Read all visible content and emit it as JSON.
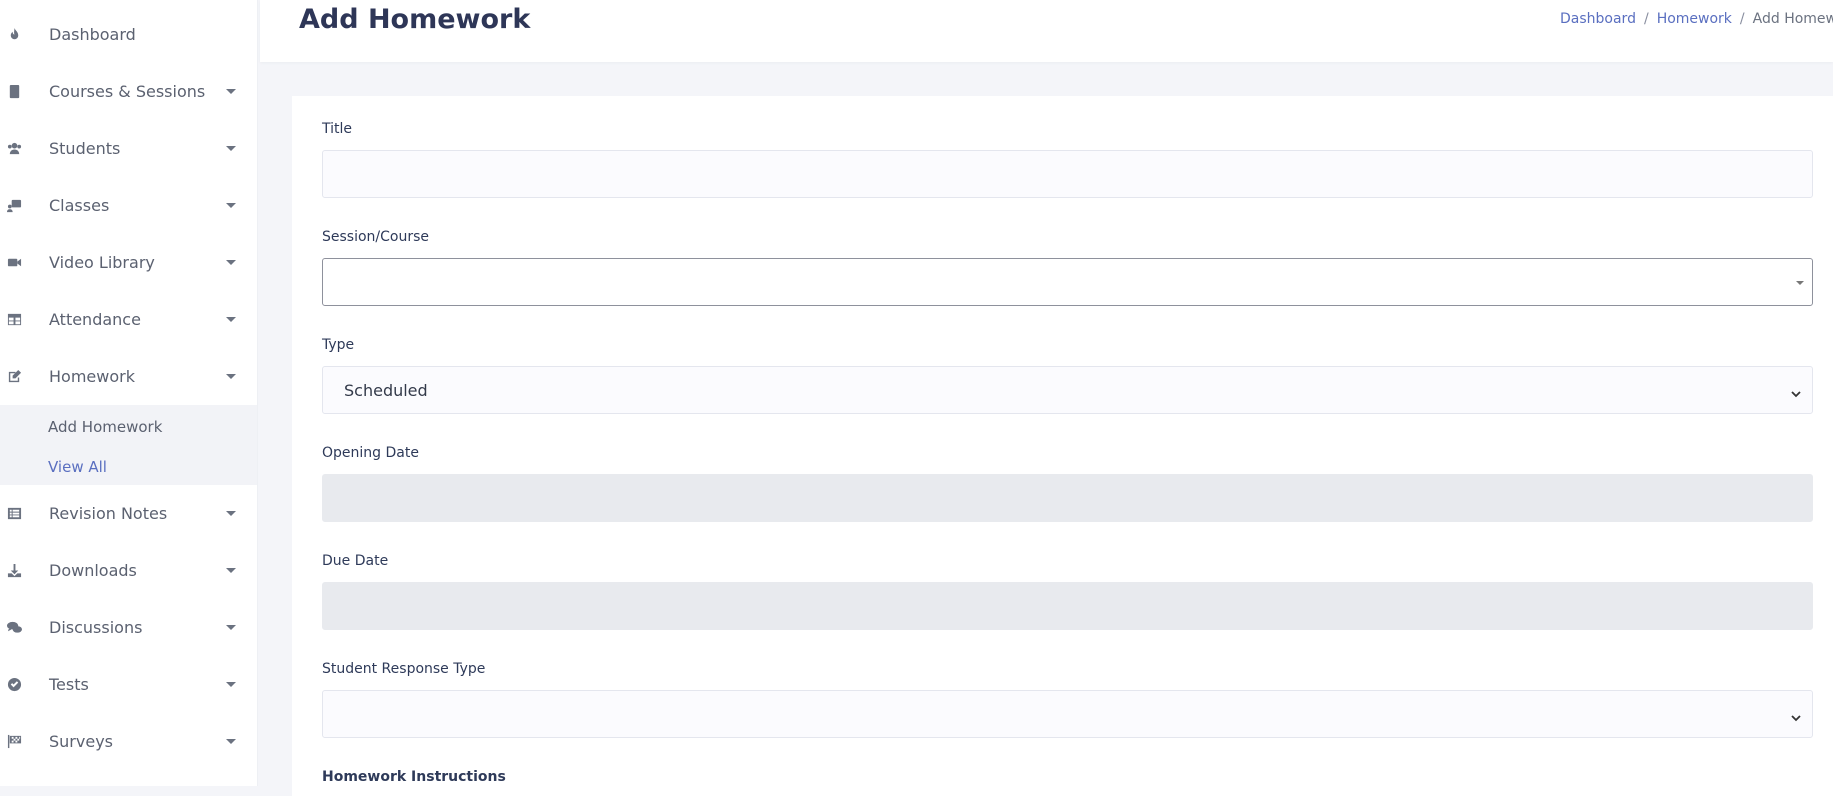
{
  "sidebar": {
    "items": [
      {
        "label": "Dashboard",
        "icon": "fire-icon",
        "has_caret": false
      },
      {
        "label": "Courses & Sessions",
        "icon": "book-icon",
        "has_caret": true
      },
      {
        "label": "Students",
        "icon": "users-icon",
        "has_caret": true
      },
      {
        "label": "Classes",
        "icon": "chalkboard-teacher-icon",
        "has_caret": true
      },
      {
        "label": "Video Library",
        "icon": "video-icon",
        "has_caret": true
      },
      {
        "label": "Attendance",
        "icon": "table-icon",
        "has_caret": true
      },
      {
        "label": "Homework",
        "icon": "edit-icon",
        "has_caret": true
      },
      {
        "label": "Revision Notes",
        "icon": "list-icon",
        "has_caret": true
      },
      {
        "label": "Downloads",
        "icon": "download-icon",
        "has_caret": true
      },
      {
        "label": "Discussions",
        "icon": "comments-icon",
        "has_caret": true
      },
      {
        "label": "Tests",
        "icon": "check-circle-icon",
        "has_caret": true
      },
      {
        "label": "Surveys",
        "icon": "flag-checkered-icon",
        "has_caret": true
      }
    ],
    "submenu": {
      "add_label": "Add Homework",
      "view_label": "View All"
    }
  },
  "header": {
    "title": "Add Homework",
    "breadcrumb": [
      "Dashboard",
      "Homework",
      "Add Homework"
    ]
  },
  "form": {
    "title_label": "Title",
    "title_value": "",
    "session_label": "Session/Course",
    "session_value": "",
    "type_label": "Type",
    "type_value": "Scheduled",
    "opening_label": "Opening Date",
    "opening_value": "",
    "due_label": "Due Date",
    "due_value": "",
    "response_label": "Student Response Type",
    "response_value": "",
    "instructions_label": "Homework Instructions"
  },
  "colors": {
    "accent": "#5a6fc0",
    "sidebar_text": "#5b6170",
    "disabled_input": "#e8eaee"
  }
}
